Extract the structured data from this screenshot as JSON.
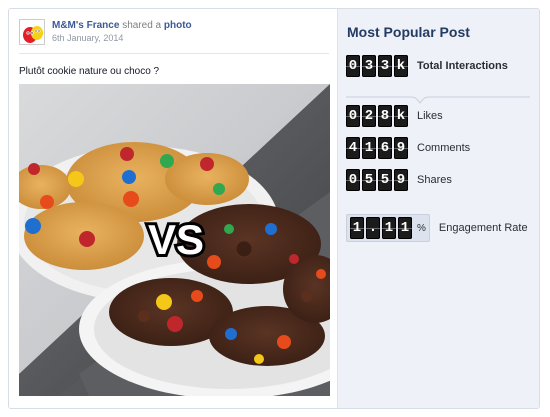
{
  "post": {
    "page_name": "M&M's France",
    "shared_text": "shared a",
    "object_text": "photo",
    "date": "6th January, 2014",
    "text": "Plutôt cookie nature ou choco ?",
    "image_overlay": "VS"
  },
  "stats": {
    "title": "Most Popular Post",
    "total": {
      "digits": [
        "0",
        "3",
        "3",
        "k"
      ],
      "label": "Total Interactions"
    },
    "likes": {
      "digits": [
        "0",
        "2",
        "8",
        "k"
      ],
      "label": "Likes"
    },
    "comments": {
      "digits": [
        "4",
        "1",
        "6",
        "9"
      ],
      "label": "Comments"
    },
    "shares": {
      "digits": [
        "0",
        "5",
        "5",
        "9"
      ],
      "label": "Shares"
    },
    "engagement": {
      "digits": [
        "1",
        ".",
        "1",
        "1"
      ],
      "suffix": "%",
      "label": "Engagement Rate"
    }
  },
  "colors": {
    "link_blue": "#3b5998",
    "title_navy": "#243b63",
    "panel_bg": "#eef1f7",
    "digit_bg": "#1b1b1b"
  }
}
